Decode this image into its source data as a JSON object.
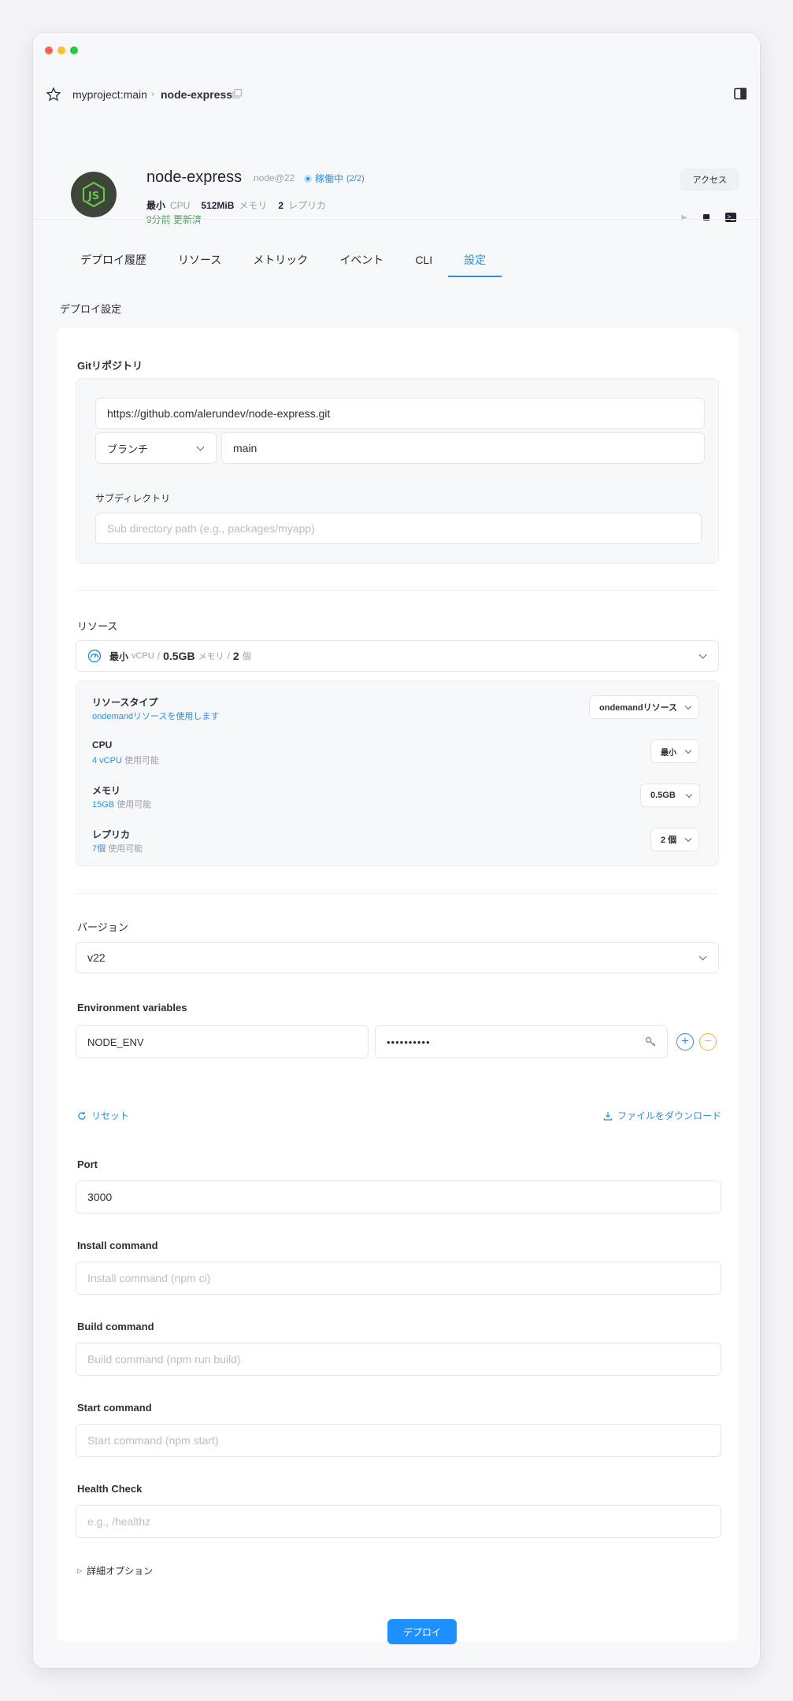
{
  "breadcrumb": {
    "project": "myproject:main",
    "current": "node-express"
  },
  "header": {
    "app_name": "node-express",
    "runtime": "node@22",
    "status": "稼働中",
    "status_count": "(2/2)",
    "specs": {
      "cpu_value": "最小",
      "cpu_label": "CPU",
      "memory_value": "512MiB",
      "memory_label": "メモリ",
      "replica_value": "2",
      "replica_label": "レプリカ"
    },
    "updated": "9分前 更新済",
    "access_label": "アクセス"
  },
  "tabs": [
    "デプロイ履歴",
    "リソース",
    "メトリック",
    "イベント",
    "CLI",
    "設定"
  ],
  "active_tab": "設定",
  "section_title": "デプロイ設定",
  "git": {
    "label": "Gitリポジトリ",
    "repo_url": "https://github.com/alerundev/node-express.git",
    "ref_type": "ブランチ",
    "branch": "main",
    "subdir_label": "サブディレクトリ",
    "subdir_placeholder": "Sub directory path (e.g., packages/myapp)"
  },
  "resources": {
    "label": "リソース",
    "summary": {
      "cpu": "最小",
      "cpu_unit": "vCPU",
      "mem": "0.5GB",
      "mem_unit": "メモリ",
      "rep": "2",
      "rep_unit": "個"
    },
    "rows": [
      {
        "title": "リソースタイプ",
        "sub": "ondemandリソースを使用します",
        "sub_muted": "",
        "value": "ondemandリソース"
      },
      {
        "title": "CPU",
        "sub": "4 vCPU",
        "sub_muted": "使用可能",
        "value": "最小"
      },
      {
        "title": "メモリ",
        "sub": "15GB",
        "sub_muted": "使用可能",
        "value": "0.5GB"
      },
      {
        "title": "レプリカ",
        "sub": "7個",
        "sub_muted": "使用可能",
        "value": "2 個"
      }
    ]
  },
  "version": {
    "label": "バージョン",
    "value": "v22"
  },
  "env": {
    "label": "Environment variables",
    "key": "NODE_ENV",
    "value_masked": "••••••••••",
    "reset_label": "リセット",
    "download_label": "ファイルをダウンロード"
  },
  "port": {
    "label": "Port",
    "value": "3000"
  },
  "install": {
    "label": "Install command",
    "placeholder": "Install command (npm ci)"
  },
  "build": {
    "label": "Build command",
    "placeholder": "Build command (npm run build)"
  },
  "start": {
    "label": "Start command",
    "placeholder": "Start command (npm start)"
  },
  "health": {
    "label": "Health Check",
    "placeholder": "e.g., /healthz"
  },
  "advanced_label": "詳細オプション",
  "deploy_label": "デプロイ",
  "colors": {
    "accent": "#2b8fe0",
    "deploy": "#1e90ff",
    "success": "#3aa84a",
    "minus": "#f2b430"
  }
}
